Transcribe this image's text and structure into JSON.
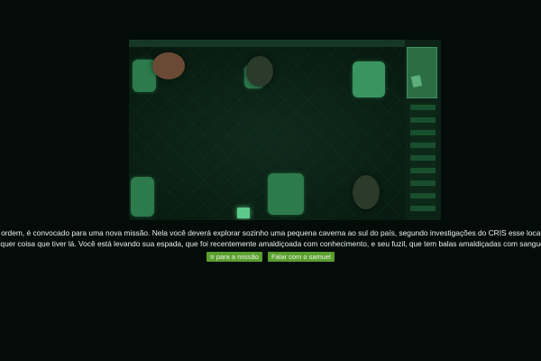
{
  "scene": {
    "image_label": "",
    "items": [
      "desk-chair",
      "desk-chair",
      "desk-chair",
      "desk-chair",
      "agent",
      "agent",
      "agent",
      "computer-monitor",
      "filing-cabinet",
      "shelf"
    ]
  },
  "story": {
    "line1": "da ordem, é convocado para uma nova missão. Nela você deverá explorar sozinho uma pequena caverna ao sul do país, segundo investigações do CRIS esse local te",
    "line2": "alquer coisa que tiver lá. Você está levando sua espada, que foi recentemente amaldiçoada com conhecimento, e seu fuzil, que tem balas amaldiçadas com sangue."
  },
  "actions": {
    "go_mission": "Ir para a missão",
    "talk_samuel": "Falar com o samuel"
  },
  "colors": {
    "background": "#030c08",
    "button": "#5a9f2f",
    "text": "#e9f2ec"
  }
}
